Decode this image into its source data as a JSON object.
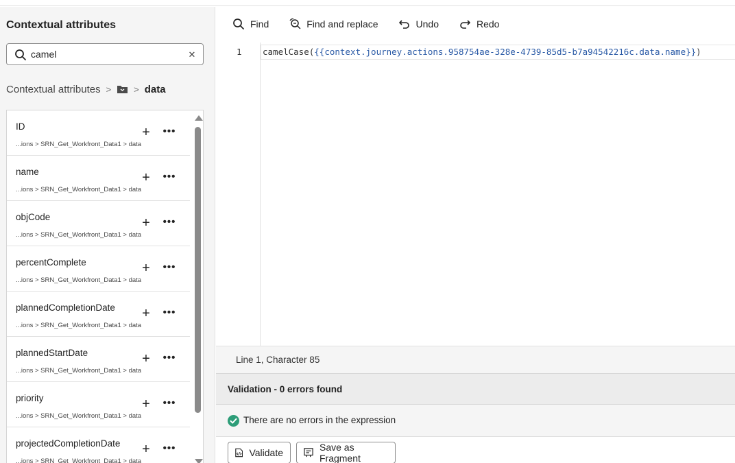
{
  "left_panel": {
    "title": "Contextual attributes",
    "search": {
      "value": "camel",
      "icon": "search-icon",
      "clear_icon": "close-icon"
    },
    "breadcrumb": {
      "root": "Contextual attributes",
      "folder_icon": "folder-icon",
      "current": "data"
    },
    "items": [
      {
        "name": "ID",
        "path": "...ions > SRN_Get_Workfront_Data1 > data"
      },
      {
        "name": "name",
        "path": "...ions > SRN_Get_Workfront_Data1 > data"
      },
      {
        "name": "objCode",
        "path": "...ions > SRN_Get_Workfront_Data1 > data"
      },
      {
        "name": "percentComplete",
        "path": "...ions > SRN_Get_Workfront_Data1 > data"
      },
      {
        "name": "plannedCompletionDate",
        "path": "...ions > SRN_Get_Workfront_Data1 > data"
      },
      {
        "name": "plannedStartDate",
        "path": "...ions > SRN_Get_Workfront_Data1 > data"
      },
      {
        "name": "priority",
        "path": "...ions > SRN_Get_Workfront_Data1 > data"
      },
      {
        "name": "projectedCompletionDate",
        "path": "...ions > SRN_Get_Workfront_Data1 > data"
      }
    ],
    "add_icon": "plus-icon",
    "more_icon": "more-icon"
  },
  "toolbar": {
    "find": "Find",
    "find_replace": "Find and replace",
    "undo": "Undo",
    "redo": "Redo"
  },
  "editor": {
    "line_number": "1",
    "code_fn": "camelCase(",
    "code_arg": "{{context.journey.actions.958754ae-328e-4739-85d5-b7a94542216c.data.name}}",
    "code_close": ")"
  },
  "status": {
    "cursor": "Line 1, Character 85"
  },
  "validation": {
    "header": "Validation - 0 errors found",
    "message": "There are no errors in the expression",
    "success_color": "#2d9d78"
  },
  "footer": {
    "validate": "Validate",
    "save_fragment": "Save as Fragment"
  }
}
